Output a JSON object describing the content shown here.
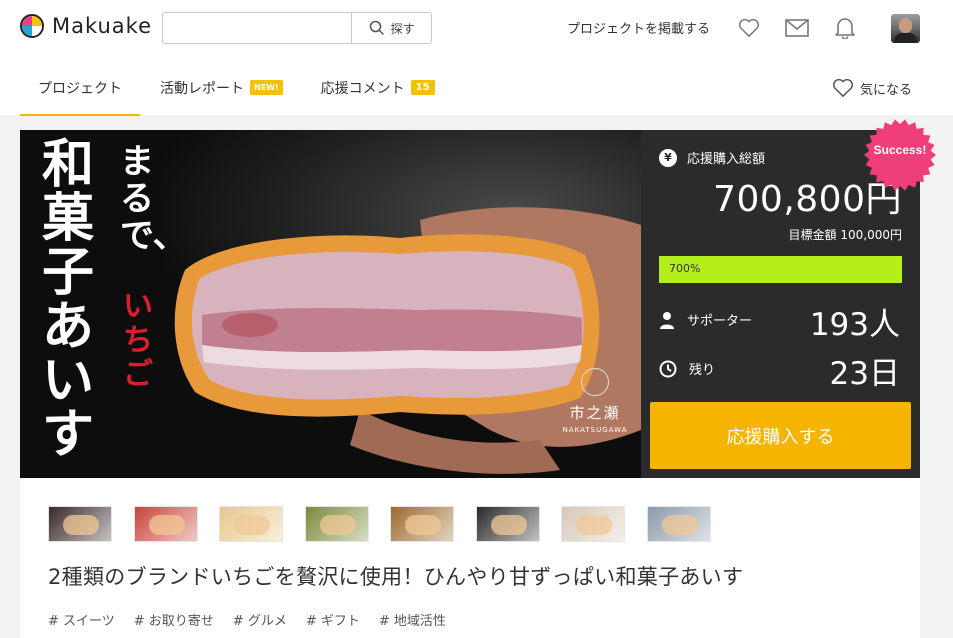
{
  "header": {
    "logo_text": "Makuake",
    "search_placeholder": "",
    "search_button": "探す",
    "post_project": "プロジェクトを掲載する",
    "icons": [
      "heart-icon",
      "mail-icon",
      "bell-icon"
    ]
  },
  "tabs": [
    {
      "label": "プロジェクト",
      "badge": ""
    },
    {
      "label": "活動レポート",
      "badge": "NEW!"
    },
    {
      "label": "応援コメント",
      "badge": "15"
    }
  ],
  "favorite_label": "気になる",
  "hero": {
    "title": "和菓子あいす",
    "subtitle": "まるで、",
    "accent": "いちご",
    "brand_kanji": "市之瀬",
    "brand_roman": "NAKATSUGAWA"
  },
  "panel": {
    "total_label": "応援購入総額",
    "amount": "700,800円",
    "goal": "目標金額 100,000円",
    "progress_text": "700%",
    "progress_fill": 1.0,
    "supporters_label": "サポーター",
    "supporters_value": "193人",
    "remaining_label": "残り",
    "remaining_value": "23日",
    "cta": "応援購入する",
    "success_badge": "Success!"
  },
  "colors": {
    "accent": "#f5b400",
    "progress": "#b4ef1a",
    "success": "#ef3e7a",
    "hero_accent": "#d8202a"
  },
  "thumbnails": [
    "#3a2a2a",
    "#c9443a",
    "#e8c88a",
    "#7a8a3a",
    "#9a6a2a",
    "#2a2a2a",
    "#d8c8b8",
    "#8a9aaa"
  ],
  "project_title": "2種類のブランドいちごを贅沢に使用！ひんやり甘ずっぱい和菓子あいす",
  "tags": [
    "# スイーツ",
    "# お取り寄せ",
    "# グルメ",
    "# ギフト",
    "# 地域活性"
  ]
}
